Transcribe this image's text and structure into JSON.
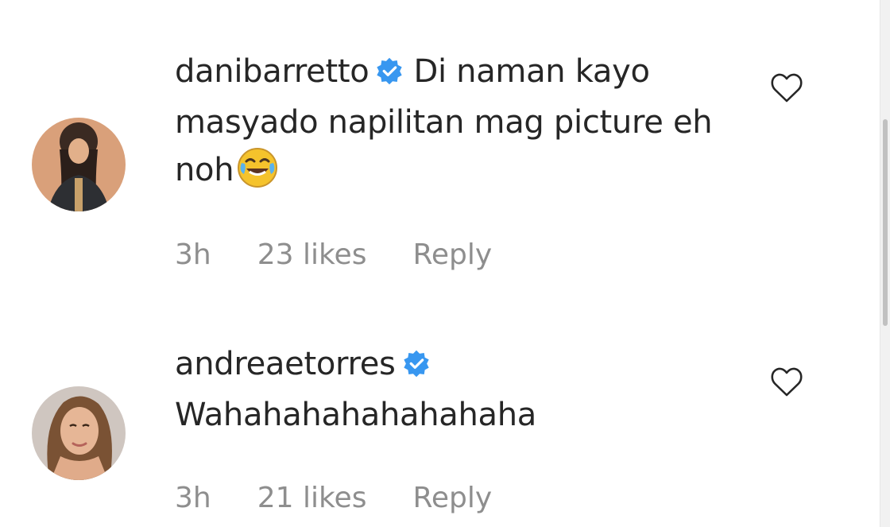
{
  "comments": [
    {
      "username": "danibarretto",
      "verified": true,
      "text": "Di naman kayo masyado napilitan mag picture eh noh",
      "emoji": "face-with-tears-of-joy",
      "time": "3h",
      "likes": "23 likes",
      "reply_label": "Reply"
    },
    {
      "username": "andreaetorres",
      "verified": true,
      "text": "Wahahahahahahahaha",
      "time": "3h",
      "likes": "21 likes",
      "reply_label": "Reply"
    }
  ],
  "colors": {
    "text": "#262626",
    "meta": "#8e8e8e",
    "verified_badge": "#3897f0",
    "background": "#ffffff"
  },
  "icons": {
    "verified": "verified-badge-icon",
    "like": "heart-outline-icon"
  }
}
